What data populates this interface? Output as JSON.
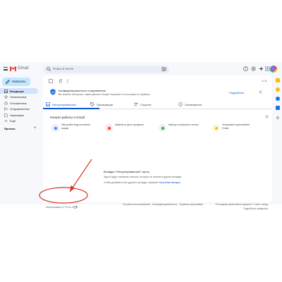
{
  "app": {
    "logo_text": "Gmail",
    "search_placeholder": "Поиск в почте",
    "compose_label": "Написать",
    "sort_label": "1–0",
    "labels_heading": "Ярлыки",
    "labels_add": "+"
  },
  "sidebar": {
    "items": [
      {
        "label": "Входящие",
        "icon": "inbox-icon",
        "active": true
      },
      {
        "label": "Помеченные",
        "icon": "star-icon",
        "active": false
      },
      {
        "label": "Отложенные",
        "icon": "clock-icon",
        "active": false
      },
      {
        "label": "Отправленные",
        "icon": "send-icon",
        "active": false
      },
      {
        "label": "Черновики",
        "icon": "draft-icon",
        "active": false
      },
      {
        "label": "Ещё",
        "icon": "chevron-down-icon",
        "active": false
      }
    ]
  },
  "notice": {
    "title": "Конфиденциальность и управление",
    "subtitle": "Вы можете настроить, какие данные Google сохраняет и использует в сервисах",
    "link": "Подробнее"
  },
  "tabs": [
    {
      "label": "Несортированные",
      "icon": "inbox-icon",
      "active": true
    },
    {
      "label": "Промоакции",
      "icon": "tag-icon",
      "active": false
    },
    {
      "label": "Соцсети",
      "icon": "people-icon",
      "active": false
    },
    {
      "label": "Оповещения",
      "icon": "info-icon",
      "active": false
    }
  ],
  "setup": {
    "title": "Начало работы в Gmail",
    "items": [
      {
        "label": "Настройте вид почтового ящика",
        "color": "#e8eefd",
        "icon_color": "#4285f4"
      },
      {
        "label": "Изменить фото профиля",
        "color": "#fce8e6",
        "icon_color": "#ea4335"
      },
      {
        "label": "Импорт контактов и почты",
        "color": "#e6f4ea",
        "icon_color": "#34a853"
      },
      {
        "label": "Установите приложение Gmail",
        "color": "#fef7e0",
        "icon_color": "#fbbc04"
      }
    ]
  },
  "empty": {
    "line1": "Вкладка \"Несортированные\" пуста.",
    "line2": "Здесь будут показаны письма, которые не попали в другие вкладки.",
    "line3_prefix": "Чтобы добавить или удалить вкладки, нажмите",
    "line3_link": "настройки вкладок"
  },
  "footer": {
    "storage": "Использовано 0 ГБ из 15 ГБ",
    "center": "Условия использования · Конфиденциальность · Правила программы",
    "right1": "Последние действия в аккаунте: 0 мин. назад",
    "right2": "Подробные сведения"
  },
  "colors": {
    "accent": "#0b57d0",
    "compose_bg": "#c2e7ff",
    "active_nav": "#d3e3fd",
    "annotation": "#d93025"
  }
}
